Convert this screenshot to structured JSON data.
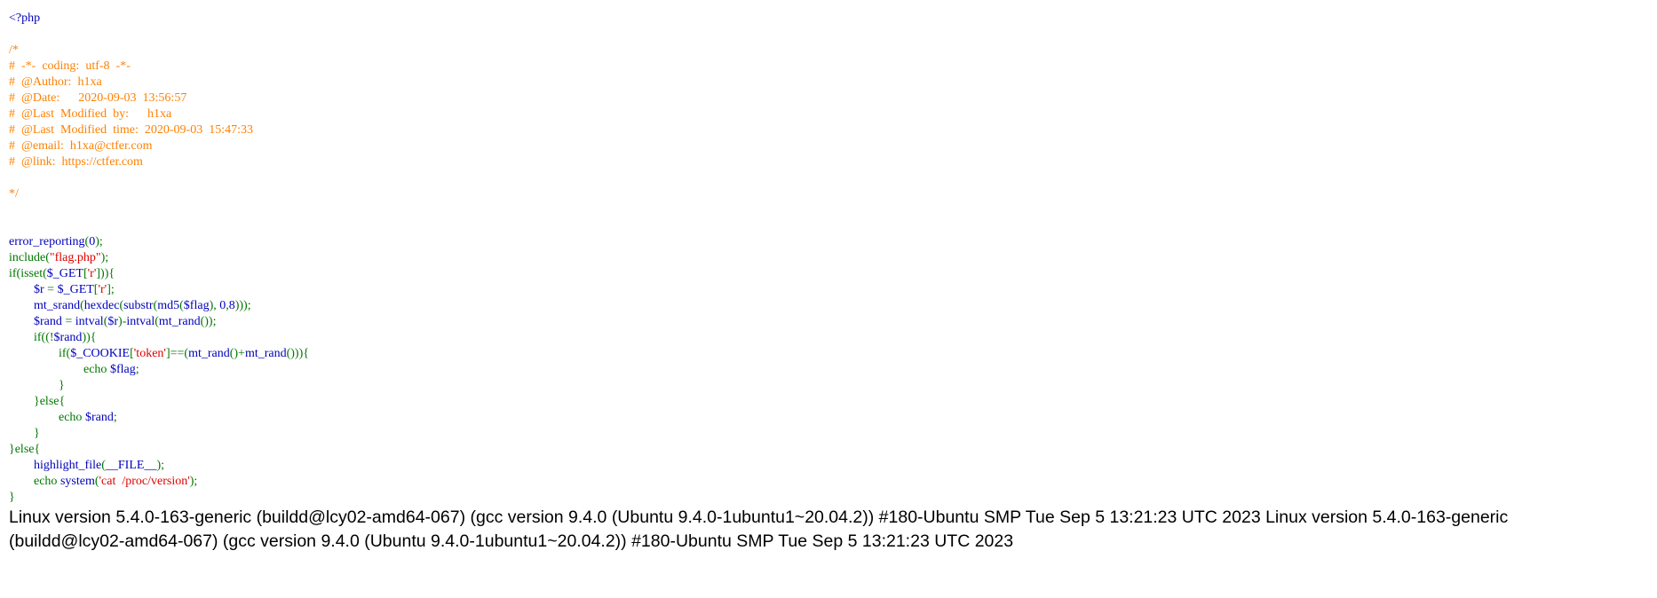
{
  "source_lines": [
    [
      {
        "t": "<?php",
        "c": "c-default"
      }
    ],
    [],
    [
      {
        "t": "/*",
        "c": "c-comment"
      }
    ],
    [
      {
        "t": "#  -*-  coding:  utf-8  -*-",
        "c": "c-comment"
      }
    ],
    [
      {
        "t": "#  @Author:  h1xa",
        "c": "c-comment"
      }
    ],
    [
      {
        "t": "#  @Date:      2020-09-03  13:56:57",
        "c": "c-comment"
      }
    ],
    [
      {
        "t": "#  @Last  Modified  by:      h1xa",
        "c": "c-comment"
      }
    ],
    [
      {
        "t": "#  @Last  Modified  time:  2020-09-03  15:47:33",
        "c": "c-comment"
      }
    ],
    [
      {
        "t": "#  @email:  h1xa@ctfer.com",
        "c": "c-comment"
      }
    ],
    [
      {
        "t": "#  @link:  https://ctfer.com",
        "c": "c-comment"
      }
    ],
    [],
    [
      {
        "t": "*/",
        "c": "c-comment"
      }
    ],
    [],
    [],
    [
      {
        "t": "error_reporting",
        "c": "c-default"
      },
      {
        "t": "(",
        "c": "c-keyword"
      },
      {
        "t": "0",
        "c": "c-default"
      },
      {
        "t": ");",
        "c": "c-keyword"
      }
    ],
    [
      {
        "t": "include(",
        "c": "c-keyword"
      },
      {
        "t": "\"flag.php\"",
        "c": "c-string"
      },
      {
        "t": ");",
        "c": "c-keyword"
      }
    ],
    [
      {
        "t": "if(isset(",
        "c": "c-keyword"
      },
      {
        "t": "$_GET",
        "c": "c-default"
      },
      {
        "t": "[",
        "c": "c-keyword"
      },
      {
        "t": "'r'",
        "c": "c-string"
      },
      {
        "t": "])){",
        "c": "c-keyword"
      }
    ],
    [
      {
        "t": "        ",
        "c": "c-default"
      },
      {
        "t": "$r ",
        "c": "c-default"
      },
      {
        "t": "= ",
        "c": "c-keyword"
      },
      {
        "t": "$_GET",
        "c": "c-default"
      },
      {
        "t": "[",
        "c": "c-keyword"
      },
      {
        "t": "'r'",
        "c": "c-string"
      },
      {
        "t": "];",
        "c": "c-keyword"
      }
    ],
    [
      {
        "t": "        ",
        "c": "c-default"
      },
      {
        "t": "mt_srand",
        "c": "c-default"
      },
      {
        "t": "(",
        "c": "c-keyword"
      },
      {
        "t": "hexdec",
        "c": "c-default"
      },
      {
        "t": "(",
        "c": "c-keyword"
      },
      {
        "t": "substr",
        "c": "c-default"
      },
      {
        "t": "(",
        "c": "c-keyword"
      },
      {
        "t": "md5",
        "c": "c-default"
      },
      {
        "t": "(",
        "c": "c-keyword"
      },
      {
        "t": "$flag",
        "c": "c-default"
      },
      {
        "t": "), ",
        "c": "c-keyword"
      },
      {
        "t": "0",
        "c": "c-default"
      },
      {
        "t": ",",
        "c": "c-keyword"
      },
      {
        "t": "8",
        "c": "c-default"
      },
      {
        "t": ")));",
        "c": "c-keyword"
      }
    ],
    [
      {
        "t": "        ",
        "c": "c-default"
      },
      {
        "t": "$rand ",
        "c": "c-default"
      },
      {
        "t": "= ",
        "c": "c-keyword"
      },
      {
        "t": "intval",
        "c": "c-default"
      },
      {
        "t": "(",
        "c": "c-keyword"
      },
      {
        "t": "$r",
        "c": "c-default"
      },
      {
        "t": ")-",
        "c": "c-keyword"
      },
      {
        "t": "intval",
        "c": "c-default"
      },
      {
        "t": "(",
        "c": "c-keyword"
      },
      {
        "t": "mt_rand",
        "c": "c-default"
      },
      {
        "t": "());",
        "c": "c-keyword"
      }
    ],
    [
      {
        "t": "        ",
        "c": "c-default"
      },
      {
        "t": "if((!",
        "c": "c-keyword"
      },
      {
        "t": "$rand",
        "c": "c-default"
      },
      {
        "t": ")){",
        "c": "c-keyword"
      }
    ],
    [
      {
        "t": "                ",
        "c": "c-default"
      },
      {
        "t": "if(",
        "c": "c-keyword"
      },
      {
        "t": "$_COOKIE",
        "c": "c-default"
      },
      {
        "t": "[",
        "c": "c-keyword"
      },
      {
        "t": "'token'",
        "c": "c-string"
      },
      {
        "t": "]==(",
        "c": "c-keyword"
      },
      {
        "t": "mt_rand",
        "c": "c-default"
      },
      {
        "t": "()+",
        "c": "c-keyword"
      },
      {
        "t": "mt_rand",
        "c": "c-default"
      },
      {
        "t": "())){",
        "c": "c-keyword"
      }
    ],
    [
      {
        "t": "                        ",
        "c": "c-default"
      },
      {
        "t": "echo ",
        "c": "c-keyword"
      },
      {
        "t": "$flag",
        "c": "c-default"
      },
      {
        "t": ";",
        "c": "c-keyword"
      }
    ],
    [
      {
        "t": "                }",
        "c": "c-keyword"
      }
    ],
    [
      {
        "t": "        }else{",
        "c": "c-keyword"
      }
    ],
    [
      {
        "t": "                ",
        "c": "c-default"
      },
      {
        "t": "echo ",
        "c": "c-keyword"
      },
      {
        "t": "$rand",
        "c": "c-default"
      },
      {
        "t": ";",
        "c": "c-keyword"
      }
    ],
    [
      {
        "t": "        }",
        "c": "c-keyword"
      }
    ],
    [
      {
        "t": "}else{",
        "c": "c-keyword"
      }
    ],
    [
      {
        "t": "        ",
        "c": "c-default"
      },
      {
        "t": "highlight_file",
        "c": "c-default"
      },
      {
        "t": "(",
        "c": "c-keyword"
      },
      {
        "t": "__FILE__",
        "c": "c-default"
      },
      {
        "t": ");",
        "c": "c-keyword"
      }
    ],
    [
      {
        "t": "        ",
        "c": "c-default"
      },
      {
        "t": "echo ",
        "c": "c-keyword"
      },
      {
        "t": "system",
        "c": "c-default"
      },
      {
        "t": "(",
        "c": "c-keyword"
      },
      {
        "t": "'cat  /proc/version'",
        "c": "c-string"
      },
      {
        "t": ");",
        "c": "c-keyword"
      }
    ],
    [
      {
        "t": "}",
        "c": "c-keyword"
      }
    ]
  ],
  "output": {
    "line1": "Linux version 5.4.0-163-generic (buildd@lcy02-amd64-067) (gcc version 9.4.0 (Ubuntu 9.4.0-1ubuntu1~20.04.2)) #180-Ubuntu SMP Tue Sep 5 13:21:23 UTC 2023 Linux version 5.4.0-163-generic",
    "line2": "(buildd@lcy02-amd64-067) (gcc version 9.4.0 (Ubuntu 9.4.0-1ubuntu1~20.04.2)) #180-Ubuntu SMP Tue Sep 5 13:21:23 UTC 2023"
  }
}
